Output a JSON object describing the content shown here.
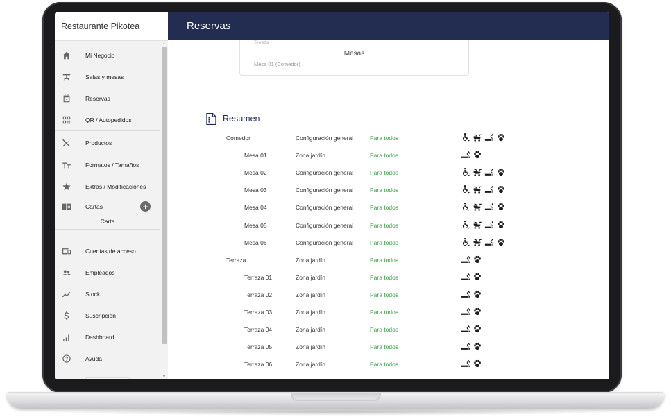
{
  "app": {
    "brand": "Restaurante Pikotea",
    "page_title": "Reservas"
  },
  "sidebar": {
    "items": [
      {
        "label": "Mi Negocio",
        "icon": "home-icon"
      },
      {
        "label": "Salas y mesas",
        "icon": "table-icon"
      },
      {
        "label": "Reservas",
        "icon": "calendar-icon"
      },
      {
        "label": "QR / Autopedidos",
        "icon": "qr-code-icon"
      },
      {
        "label": "Productos",
        "icon": "utensils-icon"
      },
      {
        "label": "Formatos / Tamaños",
        "icon": "text-size-icon"
      },
      {
        "label": "Extras / Modificaciones",
        "icon": "star-icon"
      },
      {
        "label": "Cartas",
        "icon": "menu-book-icon"
      },
      {
        "label": "Cuentas de acceso",
        "icon": "devices-icon"
      },
      {
        "label": "Empleados",
        "icon": "people-icon"
      },
      {
        "label": "Stock",
        "icon": "trend-icon"
      },
      {
        "label": "Suscripción",
        "icon": "dollar-icon"
      },
      {
        "label": "Dashboard",
        "icon": "bar-chart-icon"
      },
      {
        "label": "Ayuda",
        "icon": "help-icon"
      }
    ],
    "cartas_sub": "Carta",
    "add_symbol": "+"
  },
  "card": {
    "faded_label": "Terraza",
    "title": "Mesas",
    "subtitle": "Mesa 01 (Comedor)"
  },
  "summary": {
    "title": "Resumen",
    "rows": [
      {
        "name": "Comedor",
        "config": "Configuración general",
        "access": "Para todos",
        "icons": [
          "accessible-icon",
          "stroller-icon",
          "smoking-icon",
          "pet-paw-icon"
        ],
        "child": false
      },
      {
        "name": "Mesa 01",
        "config": "Zona jardín",
        "access": "Para todos",
        "icons": [
          "smoking-icon",
          "pet-paw-icon"
        ],
        "child": true
      },
      {
        "name": "Mesa 02",
        "config": "Configuración general",
        "access": "Para todos",
        "icons": [
          "accessible-icon",
          "stroller-icon",
          "smoking-icon",
          "pet-paw-icon"
        ],
        "child": true
      },
      {
        "name": "Mesa 03",
        "config": "Configuración general",
        "access": "Para todos",
        "icons": [
          "accessible-icon",
          "stroller-icon",
          "smoking-icon",
          "pet-paw-icon"
        ],
        "child": true
      },
      {
        "name": "Mesa 04",
        "config": "Configuración general",
        "access": "Para todos",
        "icons": [
          "accessible-icon",
          "stroller-icon",
          "smoking-icon",
          "pet-paw-icon"
        ],
        "child": true
      },
      {
        "name": "Mesa 05",
        "config": "Configuración general",
        "access": "Para todos",
        "icons": [
          "accessible-icon",
          "stroller-icon",
          "smoking-icon",
          "pet-paw-icon"
        ],
        "child": true
      },
      {
        "name": "Mesa 06",
        "config": "Configuración general",
        "access": "Para todos",
        "icons": [
          "accessible-icon",
          "stroller-icon",
          "smoking-icon",
          "pet-paw-icon"
        ],
        "child": true
      },
      {
        "name": "Terraza",
        "config": "Zona jardín",
        "access": "Para todos",
        "icons": [
          "smoking-icon",
          "pet-paw-icon"
        ],
        "child": false
      },
      {
        "name": "Terraza 01",
        "config": "Zona jardín",
        "access": "Para todos",
        "icons": [
          "smoking-icon",
          "pet-paw-icon"
        ],
        "child": true
      },
      {
        "name": "Terraza 02",
        "config": "Zona jardín",
        "access": "Para todos",
        "icons": [
          "smoking-icon",
          "pet-paw-icon"
        ],
        "child": true
      },
      {
        "name": "Terraza 03",
        "config": "Zona jardín",
        "access": "Para todos",
        "icons": [
          "smoking-icon",
          "pet-paw-icon"
        ],
        "child": true
      },
      {
        "name": "Terraza 04",
        "config": "Zona jardín",
        "access": "Para todos",
        "icons": [
          "smoking-icon",
          "pet-paw-icon"
        ],
        "child": true
      },
      {
        "name": "Terraza 05",
        "config": "Zona jardín",
        "access": "Para todos",
        "icons": [
          "smoking-icon",
          "pet-paw-icon"
        ],
        "child": true
      },
      {
        "name": "Terraza 06",
        "config": "Zona jardín",
        "access": "Para todos",
        "icons": [
          "smoking-icon",
          "pet-paw-icon"
        ],
        "child": true
      }
    ]
  },
  "colors": {
    "topbar": "#232d52",
    "access_green": "#3aa04a",
    "sidebar_bg": "#f2f2f2"
  }
}
